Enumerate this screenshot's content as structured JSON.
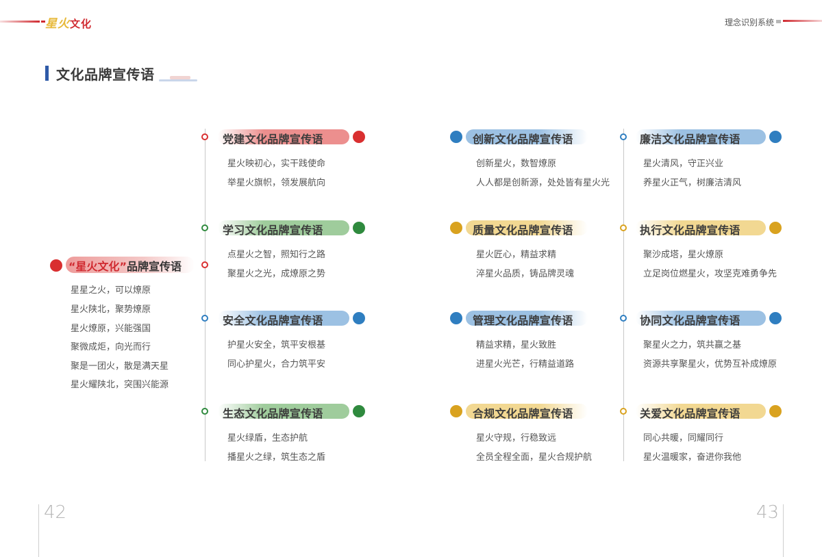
{
  "header": {
    "logo_mark": "星火",
    "logo_text": "文化",
    "right_title": "理念识别系统"
  },
  "page_title": "文化品牌宣传语",
  "main": {
    "title_quoted": "“星火文化”",
    "title_rest": "品牌宣传语",
    "slogans": [
      "星星之火，可以燎原",
      "星火陕北，聚势燎原",
      "星火燎原，兴能强国",
      "聚微成炬，向光而行",
      "聚是一团火，散是满天星",
      "星火耀陕北，突围兴能源"
    ]
  },
  "sections": [
    {
      "title": "党建文化品牌宣传语",
      "color": "#d92f30",
      "pill_color": "#ec8f8e",
      "slogans": [
        "星火映初心，实干践使命",
        "举星火旗帜，领发展航向"
      ]
    },
    {
      "title": "学习文化品牌宣传语",
      "color": "#2f8a3e",
      "pill_color": "#9fcc9c",
      "slogans": [
        "点星火之智，照知行之路",
        "聚星火之光，成燎原之势"
      ]
    },
    {
      "title": "安全文化品牌宣传语",
      "color": "#2f7ec0",
      "pill_color": "#9cc1e3",
      "slogans": [
        "护星火安全，筑平安根基",
        "同心护星火，合力筑平安"
      ]
    },
    {
      "title": "生态文化品牌宣传语",
      "color": "#2f8a3e",
      "pill_color": "#9fcc9c",
      "slogans": [
        "星火绿盾，生态护航",
        "播星火之绿，筑生态之盾"
      ]
    },
    {
      "title": "创新文化品牌宣传语",
      "color": "#2f7ec0",
      "pill_color": "#9cc1e3",
      "slogans": [
        "创新星火，数智燎原",
        "人人都是创新源，处处皆有星火光"
      ]
    },
    {
      "title": "质量文化品牌宣传语",
      "color": "#d9a21f",
      "pill_color": "#f2d892",
      "slogans": [
        "星火匠心，精益求精",
        "淬星火品质，铸品牌灵魂"
      ]
    },
    {
      "title": "管理文化品牌宣传语",
      "color": "#2f7ec0",
      "pill_color": "#9cc1e3",
      "slogans": [
        "精益求精，星火致胜",
        "进星火光芒，行精益道路"
      ]
    },
    {
      "title": "合规文化品牌宣传语",
      "color": "#d9a21f",
      "pill_color": "#f2d892",
      "slogans": [
        "星火守规，行稳致远",
        "全员全程全面，星火合规护航"
      ]
    },
    {
      "title": "廉洁文化品牌宣传语",
      "color": "#2f7ec0",
      "pill_color": "#9cc1e3",
      "slogans": [
        "星火清风，守正兴业",
        "养星火正气，树廉洁清风"
      ]
    },
    {
      "title": "执行文化品牌宣传语",
      "color": "#d9a21f",
      "pill_color": "#f2d892",
      "slogans": [
        "聚沙成塔，星火燎原",
        "立足岗位燃星火，攻坚克难勇争先"
      ]
    },
    {
      "title": "协同文化品牌宣传语",
      "color": "#2f7ec0",
      "pill_color": "#9cc1e3",
      "slogans": [
        "聚星火之力，筑共赢之基",
        "资源共享聚星火，优势互补成燎原"
      ]
    },
    {
      "title": "关爱文化品牌宣传语",
      "color": "#d9a21f",
      "pill_color": "#f2d892",
      "slogans": [
        "同心共暖，同耀同行",
        "星火温暖家，奋进你我他"
      ]
    }
  ],
  "page_numbers": {
    "left": "42",
    "right": "43"
  }
}
